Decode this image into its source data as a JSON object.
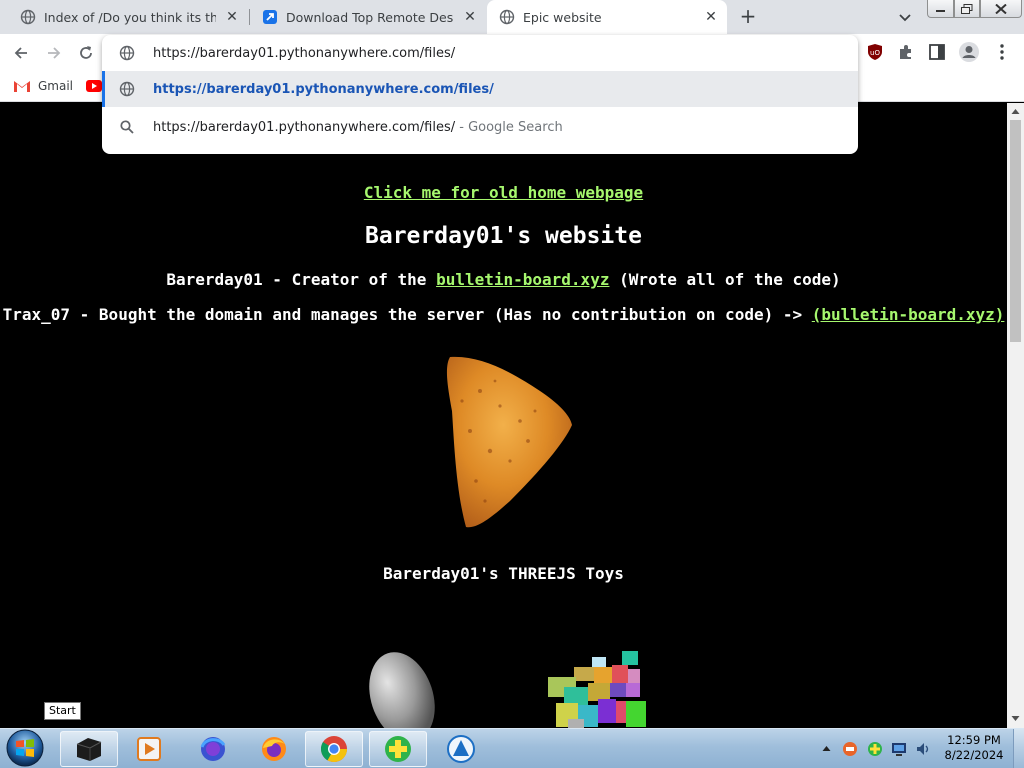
{
  "tabs": [
    {
      "title": "Index of /Do you think its that ea",
      "favicon": "globe-icon"
    },
    {
      "title": "Download Top Remote Desktop S",
      "favicon": "remote-desktop-icon"
    },
    {
      "title": "Epic website",
      "favicon": "globe-icon",
      "active": true
    }
  ],
  "address_bar": {
    "value": "https://barerday01.pythonanywhere.com/files/"
  },
  "omnibox_suggestions": [
    {
      "text": "https://barerday01.pythonanywhere.com/files/",
      "icon": "globe-icon",
      "selected": true
    },
    {
      "text": "https://barerday01.pythonanywhere.com/files/",
      "suffix": " - Google Search",
      "icon": "search-icon"
    }
  ],
  "bookmarks": [
    {
      "label": "Gmail",
      "icon": "gmail-icon"
    },
    {
      "label": "",
      "icon": "youtube-icon"
    }
  ],
  "page": {
    "old_home_link": "Click me for old home webpage",
    "site_title": "Barerday01's website",
    "creator_line": {
      "prefix": "Barerday01 - Creator of the ",
      "link": "bulletin-board.xyz",
      "suffix": " (Wrote all of the code)"
    },
    "owner_line": {
      "prefix": "Trax_07 - Bought the domain and manages the server (Has no contribution on code) -> ",
      "link": "(bulletin-board.xyz)"
    },
    "toys_title": "Barerday01's THREEJS Toys"
  },
  "taskbar": {
    "start_tooltip": "Start",
    "time": "12:59 PM",
    "date": "8/22/2024",
    "items": [
      "terminal-icon",
      "media-player-icon",
      "firefox-dev-icon",
      "firefox-icon",
      "chrome-icon",
      "add-icon",
      "teamviewer-icon"
    ]
  },
  "colors": {
    "link_green": "#a6f76e",
    "page_bg": "#000000",
    "tab_strip": "#dee1e6",
    "selected_accent": "#1a73e8"
  }
}
